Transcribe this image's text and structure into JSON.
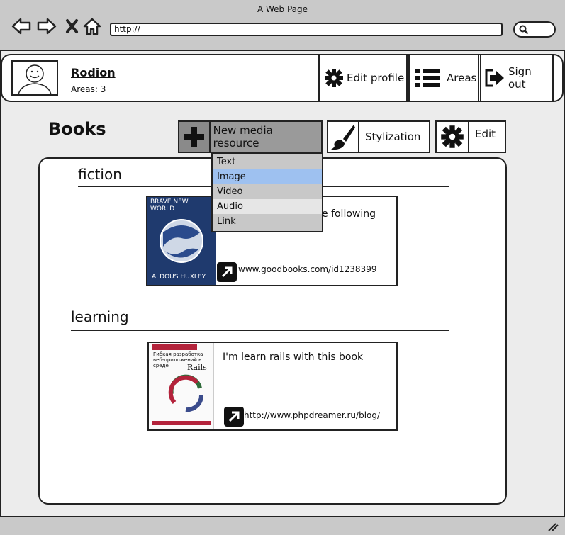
{
  "window": {
    "title": "A Web Page",
    "url": "http://"
  },
  "user": {
    "name": "Rodion",
    "areas": "Areas: 3"
  },
  "header_buttons": {
    "edit_profile": "Edit profile",
    "areas": "Areas",
    "sign_out": "Sign out"
  },
  "page": {
    "title": "Books"
  },
  "toolbar": {
    "new_media": "New media resource",
    "stylization": "Stylization",
    "edit": "Edit"
  },
  "dropdown": {
    "items": [
      "Text",
      "Image",
      "Video",
      "Audio",
      "Link"
    ],
    "selected": "Image"
  },
  "sections": [
    {
      "name": "fiction",
      "card": {
        "text": "e following",
        "link": "www.goodbooks.com/id1238399",
        "cover": {
          "title": "BRAVE NEW WORLD",
          "author": "ALDOUS HUXLEY"
        }
      }
    },
    {
      "name": "learning",
      "card": {
        "text": "I'm learn rails with this book",
        "link": "http://www.phpdreamer.ru/blog/",
        "cover": {
          "title": "Гибкая разработка веб-приложений в среде",
          "subtitle": "Rails"
        }
      }
    }
  ]
}
